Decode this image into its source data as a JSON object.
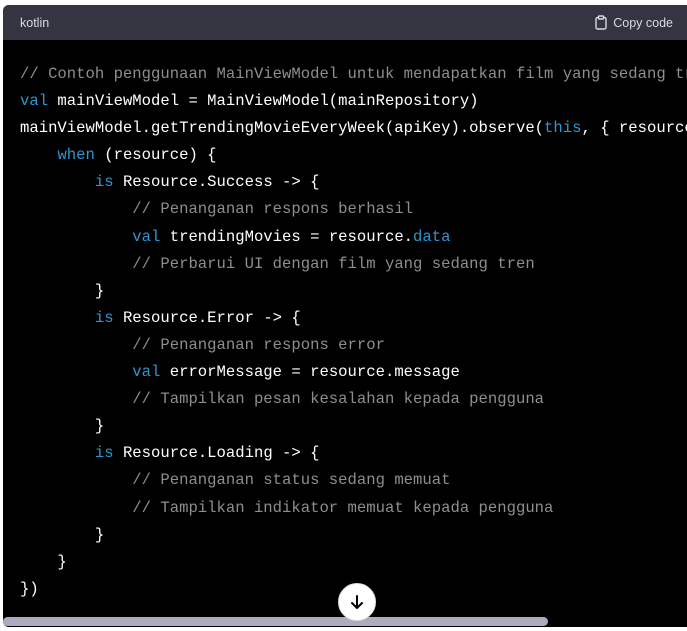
{
  "header": {
    "language": "kotlin",
    "copy_label": "Copy code"
  },
  "icons": {
    "copy": "clipboard-icon",
    "scroll_down": "arrow-down-icon"
  },
  "colors": {
    "comment": "#8e8e8e",
    "keyword": "#2e95d3",
    "text": "#ffffff",
    "header_bg": "#343541"
  },
  "code_lines": [
    [
      [
        "c",
        "// Contoh penggunaan MainViewModel untuk mendapatkan film yang sedang tren"
      ]
    ],
    [
      [
        "k",
        "val"
      ],
      [
        "t",
        " mainViewModel = MainViewModel(mainRepository)"
      ]
    ],
    [
      [
        "t",
        "mainViewModel.getTrendingMovieEveryWeek(apiKey).observe("
      ],
      [
        "k",
        "this"
      ],
      [
        "t",
        ", { resource ->"
      ]
    ],
    [
      [
        "t",
        "    "
      ],
      [
        "k",
        "when"
      ],
      [
        "t",
        " (resource) {"
      ]
    ],
    [
      [
        "t",
        "        "
      ],
      [
        "k",
        "is"
      ],
      [
        "t",
        " Resource.Success -> {"
      ]
    ],
    [
      [
        "t",
        "            "
      ],
      [
        "c",
        "// Penanganan respons berhasil"
      ]
    ],
    [
      [
        "t",
        "            "
      ],
      [
        "k",
        "val"
      ],
      [
        "t",
        " trendingMovies = resource."
      ],
      [
        "k",
        "data"
      ]
    ],
    [
      [
        "t",
        "            "
      ],
      [
        "c",
        "// Perbarui UI dengan film yang sedang tren"
      ]
    ],
    [
      [
        "t",
        "        }"
      ]
    ],
    [
      [
        "t",
        "        "
      ],
      [
        "k",
        "is"
      ],
      [
        "t",
        " Resource.Error -> {"
      ]
    ],
    [
      [
        "t",
        "            "
      ],
      [
        "c",
        "// Penanganan respons error"
      ]
    ],
    [
      [
        "t",
        "            "
      ],
      [
        "k",
        "val"
      ],
      [
        "t",
        " errorMessage = resource.message"
      ]
    ],
    [
      [
        "t",
        "            "
      ],
      [
        "c",
        "// Tampilkan pesan kesalahan kepada pengguna"
      ]
    ],
    [
      [
        "t",
        "        }"
      ]
    ],
    [
      [
        "t",
        "        "
      ],
      [
        "k",
        "is"
      ],
      [
        "t",
        " Resource.Loading -> {"
      ]
    ],
    [
      [
        "t",
        "            "
      ],
      [
        "c",
        "// Penanganan status sedang memuat"
      ]
    ],
    [
      [
        "t",
        "            "
      ],
      [
        "c",
        "// Tampilkan indikator memuat kepada pengguna"
      ]
    ],
    [
      [
        "t",
        "        }"
      ]
    ],
    [
      [
        "t",
        "    }"
      ]
    ],
    [
      [
        "t",
        "})"
      ]
    ]
  ]
}
